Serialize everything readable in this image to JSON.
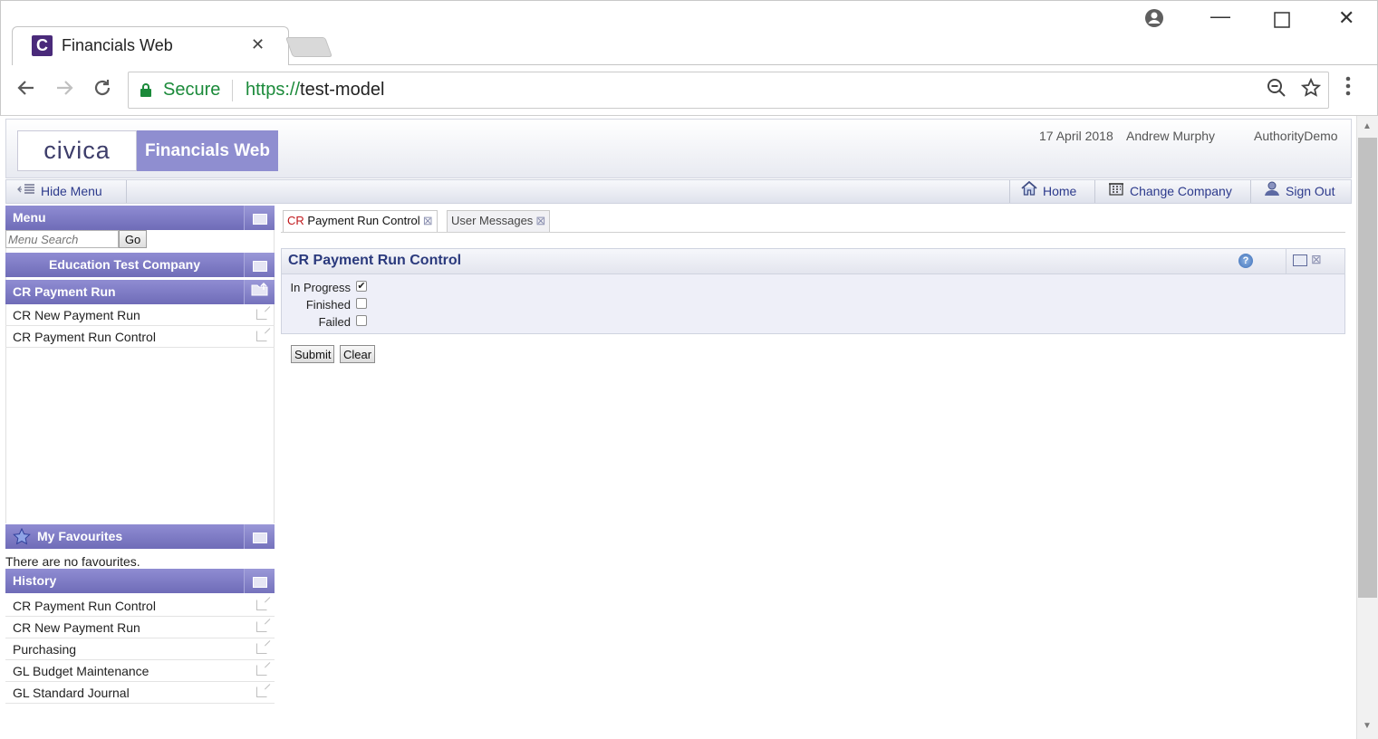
{
  "browser": {
    "tab_title": "Financials Web",
    "tab_favicon_letter": "C",
    "secure_label": "Secure",
    "url_scheme": "https://",
    "url_host": "test-model",
    "accent_green": "#1b8a3a"
  },
  "header": {
    "logo_civica": "civica",
    "logo_product": "Financials Web",
    "date": "17 April 2018",
    "user": "Andrew Murphy",
    "authority": "AuthorityDemo"
  },
  "toolbar": {
    "hide_menu": "Hide Menu",
    "home": "Home",
    "change_company": "Change Company",
    "sign_out": "Sign Out"
  },
  "menu": {
    "title": "Menu",
    "search_placeholder": "Menu Search",
    "go_label": "Go",
    "company": "Education Test Company",
    "section": "CR Payment Run",
    "items": [
      {
        "label": "CR New Payment Run"
      },
      {
        "label": "CR Payment Run Control"
      }
    ]
  },
  "favourites": {
    "title": "My Favourites",
    "empty_text": "There are no favourites."
  },
  "history": {
    "title": "History",
    "items": [
      {
        "label": "CR Payment Run Control"
      },
      {
        "label": "CR New Payment Run"
      },
      {
        "label": "Purchasing"
      },
      {
        "label": "GL Budget Maintenance"
      },
      {
        "label": "GL Standard Journal"
      }
    ]
  },
  "tabs": [
    {
      "prefix": "CR",
      "label": " Payment Run Control",
      "active": true
    },
    {
      "prefix": "",
      "label": "User Messages",
      "active": false
    }
  ],
  "form": {
    "title": "CR Payment Run Control",
    "help_icon": "?",
    "checkboxes": [
      {
        "label": "In Progress",
        "checked": true
      },
      {
        "label": "Finished",
        "checked": false
      },
      {
        "label": "Failed",
        "checked": false
      }
    ],
    "submit_label": "Submit",
    "clear_label": "Clear"
  },
  "theme": {
    "panel_purple": "#7572bd",
    "title_blue": "#2b3a7d"
  }
}
